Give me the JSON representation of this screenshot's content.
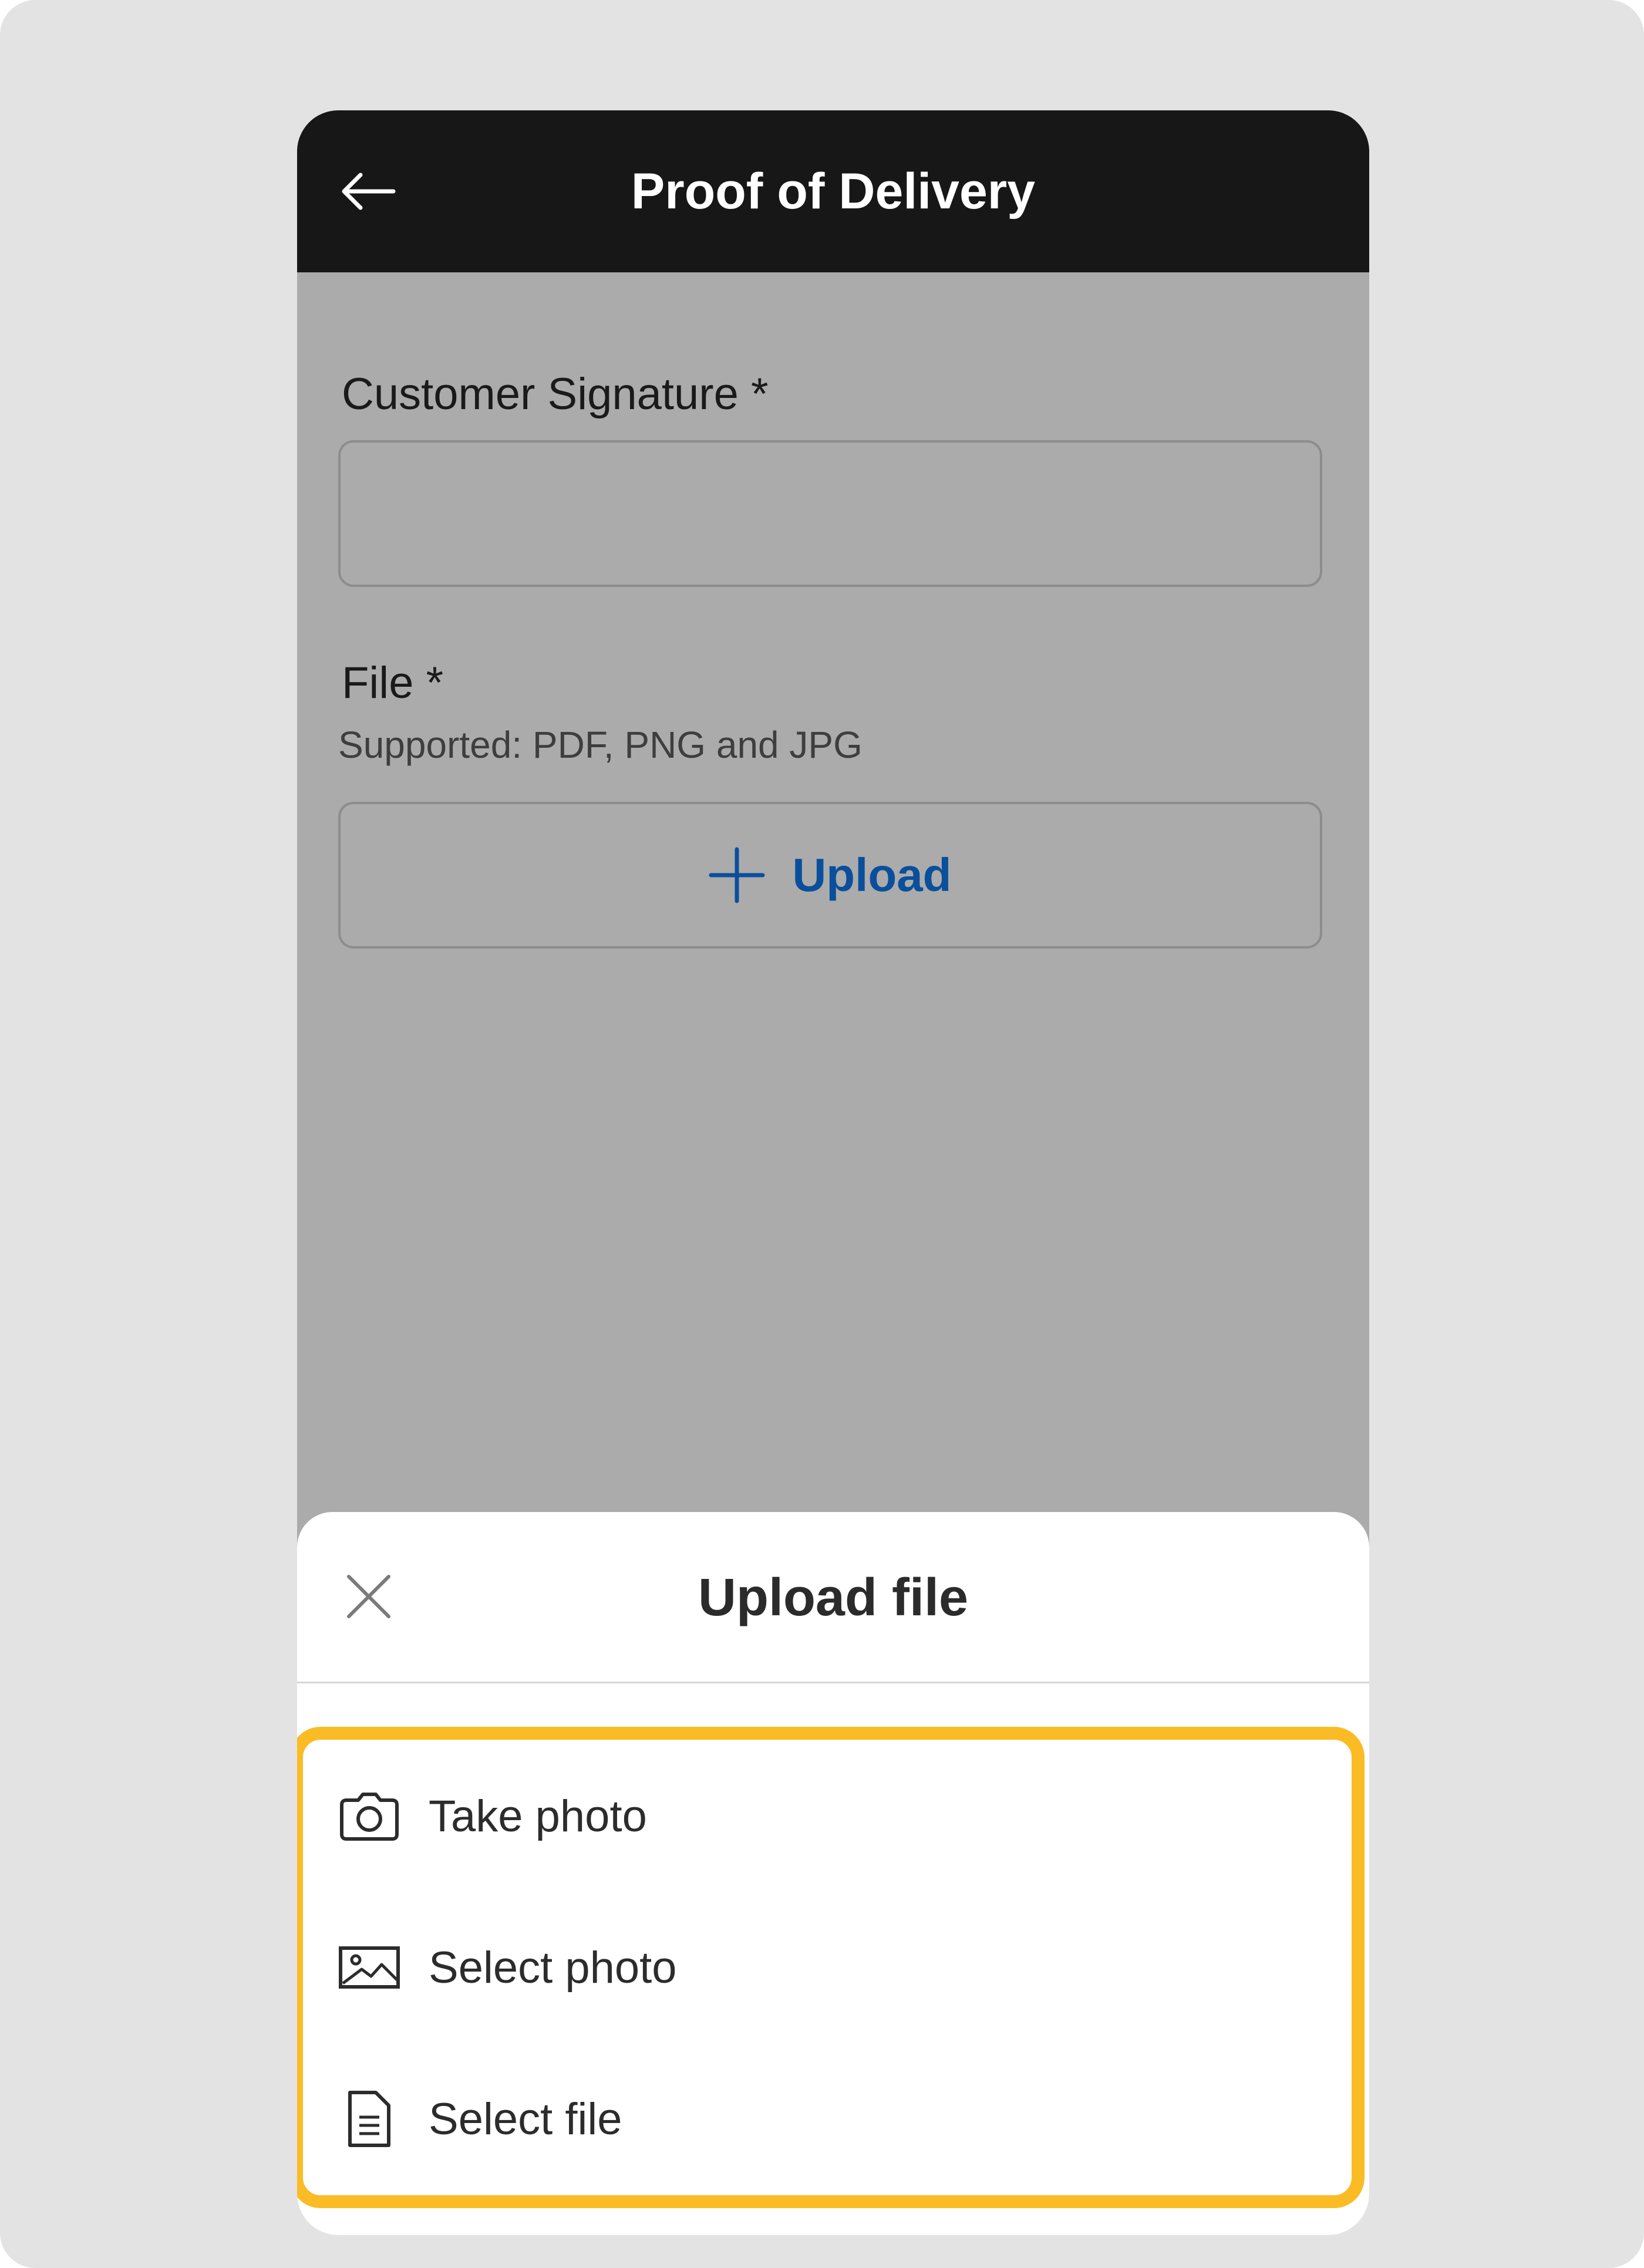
{
  "app_bar": {
    "title": "Proof of Delivery",
    "back_icon": "arrow-left-icon"
  },
  "form": {
    "signature": {
      "label": "Customer Signature *",
      "value": ""
    },
    "file": {
      "label": "File *",
      "hint": "Supported: PDF, PNG and JPG",
      "upload_label": "Upload",
      "upload_icon": "plus-icon"
    }
  },
  "sheet": {
    "title": "Upload file",
    "close_icon": "close-icon",
    "highlight_color": "#fbbb25",
    "options": [
      {
        "label": "Take photo",
        "icon": "camera-icon"
      },
      {
        "label": "Select photo",
        "icon": "image-icon"
      },
      {
        "label": "Select file",
        "icon": "document-icon"
      }
    ]
  },
  "colors": {
    "app_bar": "#171717",
    "accent": "#0a4f9c",
    "overlay": "#ababab"
  }
}
